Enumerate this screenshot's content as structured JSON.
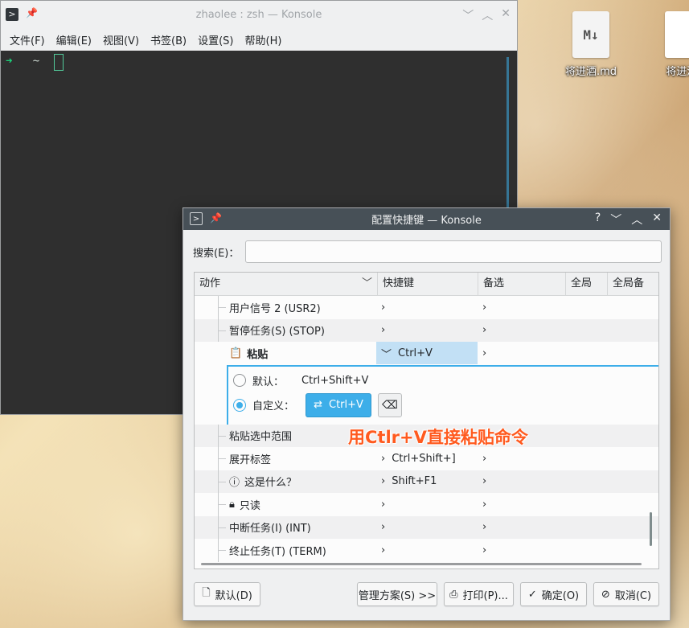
{
  "desktop": {
    "icons": [
      {
        "label": "将进酒.md",
        "glyph": "M↓"
      },
      {
        "label": "将进酒."
      }
    ]
  },
  "terminal_window": {
    "title": "zhaolee : zsh — Konsole",
    "menu": [
      "文件(F)",
      "编辑(E)",
      "视图(V)",
      "书签(B)",
      "设置(S)",
      "帮助(H)"
    ],
    "prompt_arrow": "➜",
    "prompt_path": "~"
  },
  "dialog": {
    "title": "配置快捷键 — Konsole",
    "title_controls": [
      "?",
      "﹀",
      "︿",
      "✕"
    ],
    "search_label": "搜索(E)：",
    "search_value": "",
    "columns": [
      "动作",
      "快捷键",
      "备选",
      "全局",
      "全局备"
    ],
    "rows": [
      {
        "action": "用户信号 2 (USR2)",
        "shortcut": "",
        "alternate": ""
      },
      {
        "action": "暂停任务(S) (STOP)",
        "shortcut": "",
        "alternate": ""
      },
      {
        "action": "粘贴",
        "shortcut": "Ctrl+V",
        "alternate": ""
      },
      {
        "action": "粘贴选中范围",
        "shortcut": "",
        "alternate": ""
      },
      {
        "action": "展开标签",
        "shortcut": "Ctrl+Shift+]",
        "alternate": ""
      },
      {
        "action": "这是什么？",
        "shortcut": "Shift+F1",
        "alternate": ""
      },
      {
        "action": "只读",
        "shortcut": "",
        "alternate": ""
      },
      {
        "action": "中断任务(I) (INT)",
        "shortcut": "",
        "alternate": ""
      },
      {
        "action": "终止任务(T) (TERM)",
        "shortcut": "",
        "alternate": ""
      }
    ],
    "editor": {
      "default_label": "默认：",
      "default_value": "Ctrl+Shift+V",
      "custom_label": "自定义：",
      "custom_value": "Ctrl+V",
      "selected": "custom"
    },
    "buttons": {
      "defaults": "默认(D)",
      "manage": "管理方案(S) >>",
      "print": "打印(P)...",
      "ok": "确定(O)",
      "cancel": "取消(C)"
    }
  },
  "annotation": "用Ctlr+V直接粘贴命令",
  "colors": {
    "accent": "#3daee9",
    "terminal_bg": "#2f2f2f",
    "annotation": "#ff5a1f"
  }
}
